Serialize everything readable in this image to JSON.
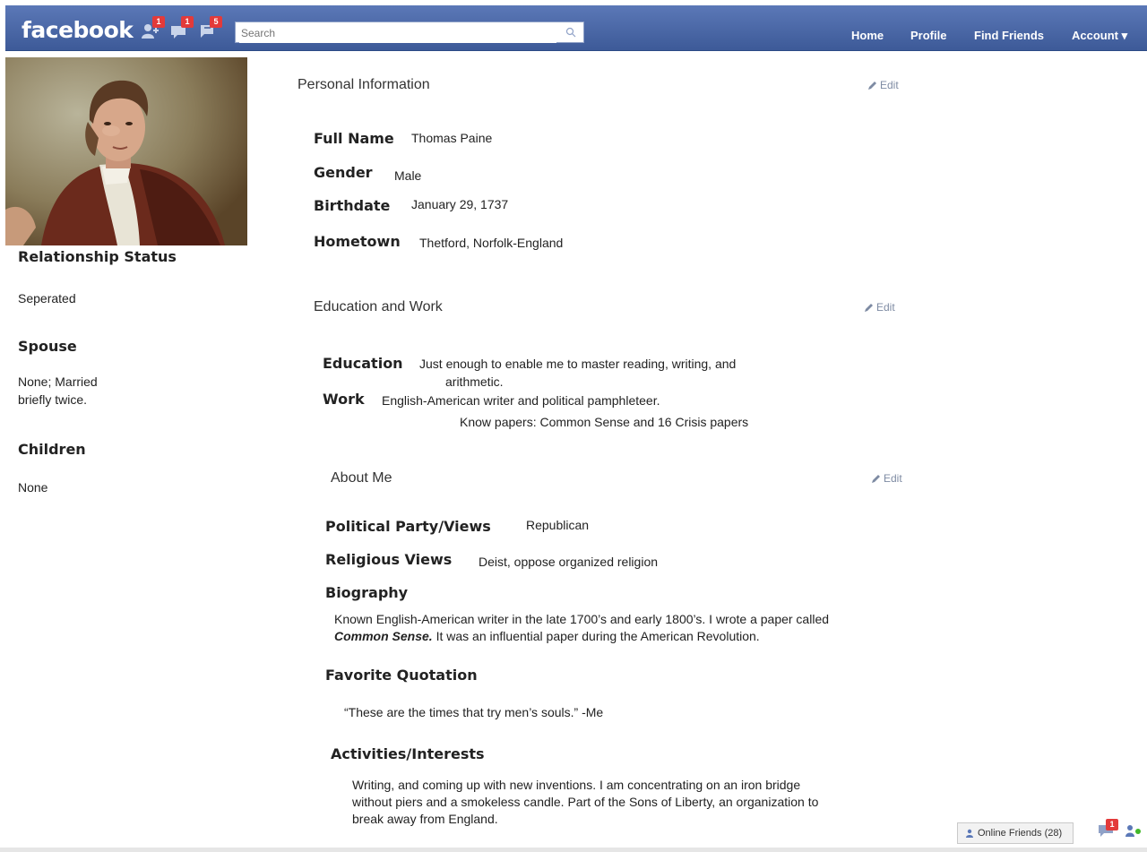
{
  "header": {
    "logo": "facebook",
    "badges": {
      "friend_requests": "1",
      "messages": "1",
      "notifications": "5"
    },
    "search_placeholder": "Search",
    "nav": {
      "home": "Home",
      "profile": "Profile",
      "find_friends": "Find Friends",
      "account": "Account ▾"
    }
  },
  "sidebar": {
    "relationship_heading": "Relationship Status",
    "relationship_value": "Seperated",
    "spouse_heading": "Spouse",
    "spouse_value_line1": "None; Married",
    "spouse_value_line2": "briefly twice.",
    "children_heading": "Children",
    "children_value": "None"
  },
  "personal": {
    "title": "Personal Information",
    "edit": "Edit",
    "full_name_label": "Full Name",
    "full_name": "Thomas Paine",
    "gender_label": "Gender",
    "gender": "Male",
    "birthdate_label": "Birthdate",
    "birthdate": "January 29, 1737",
    "hometown_label": "Hometown",
    "hometown": "Thetford, Norfolk-England"
  },
  "education": {
    "title": "Education and Work",
    "edit": "Edit",
    "education_label": "Education",
    "education_line1": "Just enough to enable me  to master reading, writing, and",
    "education_line2": "arithmetic.",
    "work_label": "Work",
    "work_line1": "English-American writer and political pamphleteer.",
    "work_line2": "Know papers: Common Sense and 16 Crisis papers"
  },
  "about": {
    "title": "About Me",
    "edit": "Edit",
    "political_label": "Political Party/Views",
    "political": "Republican",
    "religious_label": "Religious Views",
    "religious": "Deist, oppose organized religion",
    "biography_label": "Biography",
    "bio_line1": "Known English-American writer in the late 1700’s and early 1800’s. I wrote a paper called",
    "bio_italic": "Common Sense.",
    "bio_line2_rest": " It was an influential paper during the American Revolution.",
    "quotation_label": "Favorite Quotation",
    "quotation": "“These are the times that try men’s souls.” -Me",
    "activities_label": "Activities/Interests",
    "act_line1": "Writing, and coming up with new inventions. I am concentrating on an iron bridge",
    "act_line2": "without piers and a smokeless candle. Part of the Sons of Liberty, an organization to",
    "act_line3": "break away from England."
  },
  "footer": {
    "online_friends": "Online Friends (28)",
    "chat_badge": "1"
  },
  "colors": {
    "bar_top": "#5b78b7",
    "bar_bottom": "#3d5a98",
    "badge": "#e33a3a",
    "edit_link": "#7e8ba3"
  }
}
